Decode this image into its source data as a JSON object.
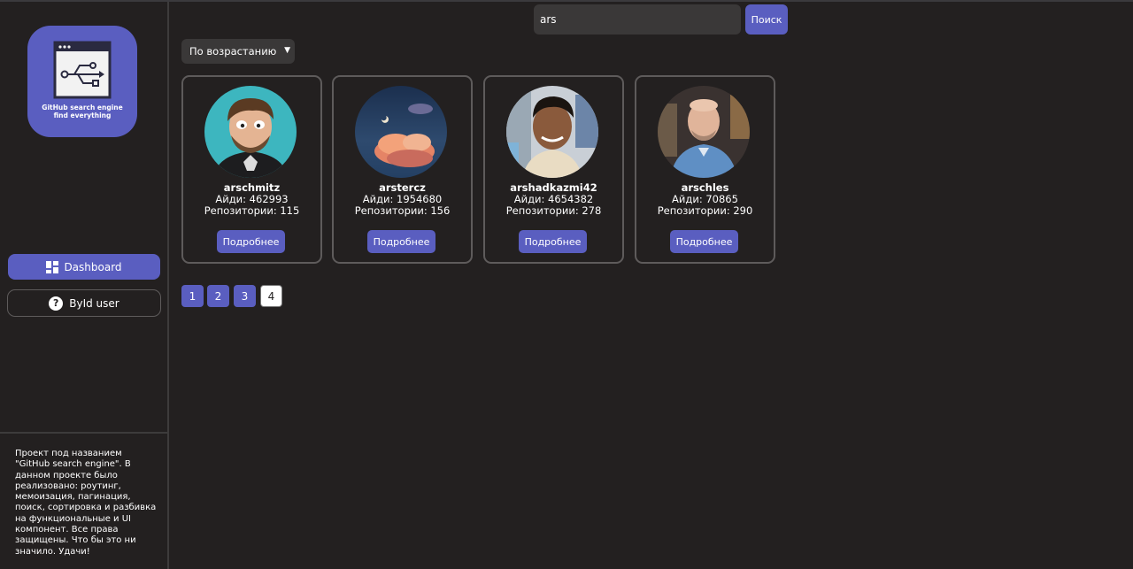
{
  "sidebar": {
    "logo": {
      "line1": "GitHub search engine",
      "line2": "find everything",
      "icon": "usb-window-icon"
    },
    "nav": [
      {
        "label": "Dashboard",
        "icon": "dashboard-grid-icon"
      },
      {
        "label": "ById user",
        "icon": "question-icon"
      }
    ],
    "about": "Проект под названием \"GitHub search engine\". В данном проекте было реализовано: роутинг, мемоизация, пагинация, поиск, сортировка и разбивка на функциональные и UI компонент. Все права защищены. Что бы это ни значило. Удачи!"
  },
  "search": {
    "value": "ars",
    "button_label": "Поиск"
  },
  "sort": {
    "selected": "По возрастанию"
  },
  "users": [
    {
      "login": "arschmitz",
      "id_line": "Айди: 462993",
      "repos_line": "Репозитории: 115",
      "button": "Подробнее"
    },
    {
      "login": "arstercz",
      "id_line": "Айди: 1954680",
      "repos_line": "Репозитории: 156",
      "button": "Подробнее"
    },
    {
      "login": "arshadkazmi42",
      "id_line": "Айди: 4654382",
      "repos_line": "Репозитории: 278",
      "button": "Подробнее"
    },
    {
      "login": "arschles",
      "id_line": "Айди: 70865",
      "repos_line": "Репозитории: 290",
      "button": "Подробнее"
    }
  ],
  "pagination": {
    "pages": [
      "1",
      "2",
      "3",
      "4"
    ],
    "current": "4"
  },
  "colors": {
    "accent": "#5a5ec0",
    "background": "#232020",
    "border": "#5e5b5b"
  }
}
